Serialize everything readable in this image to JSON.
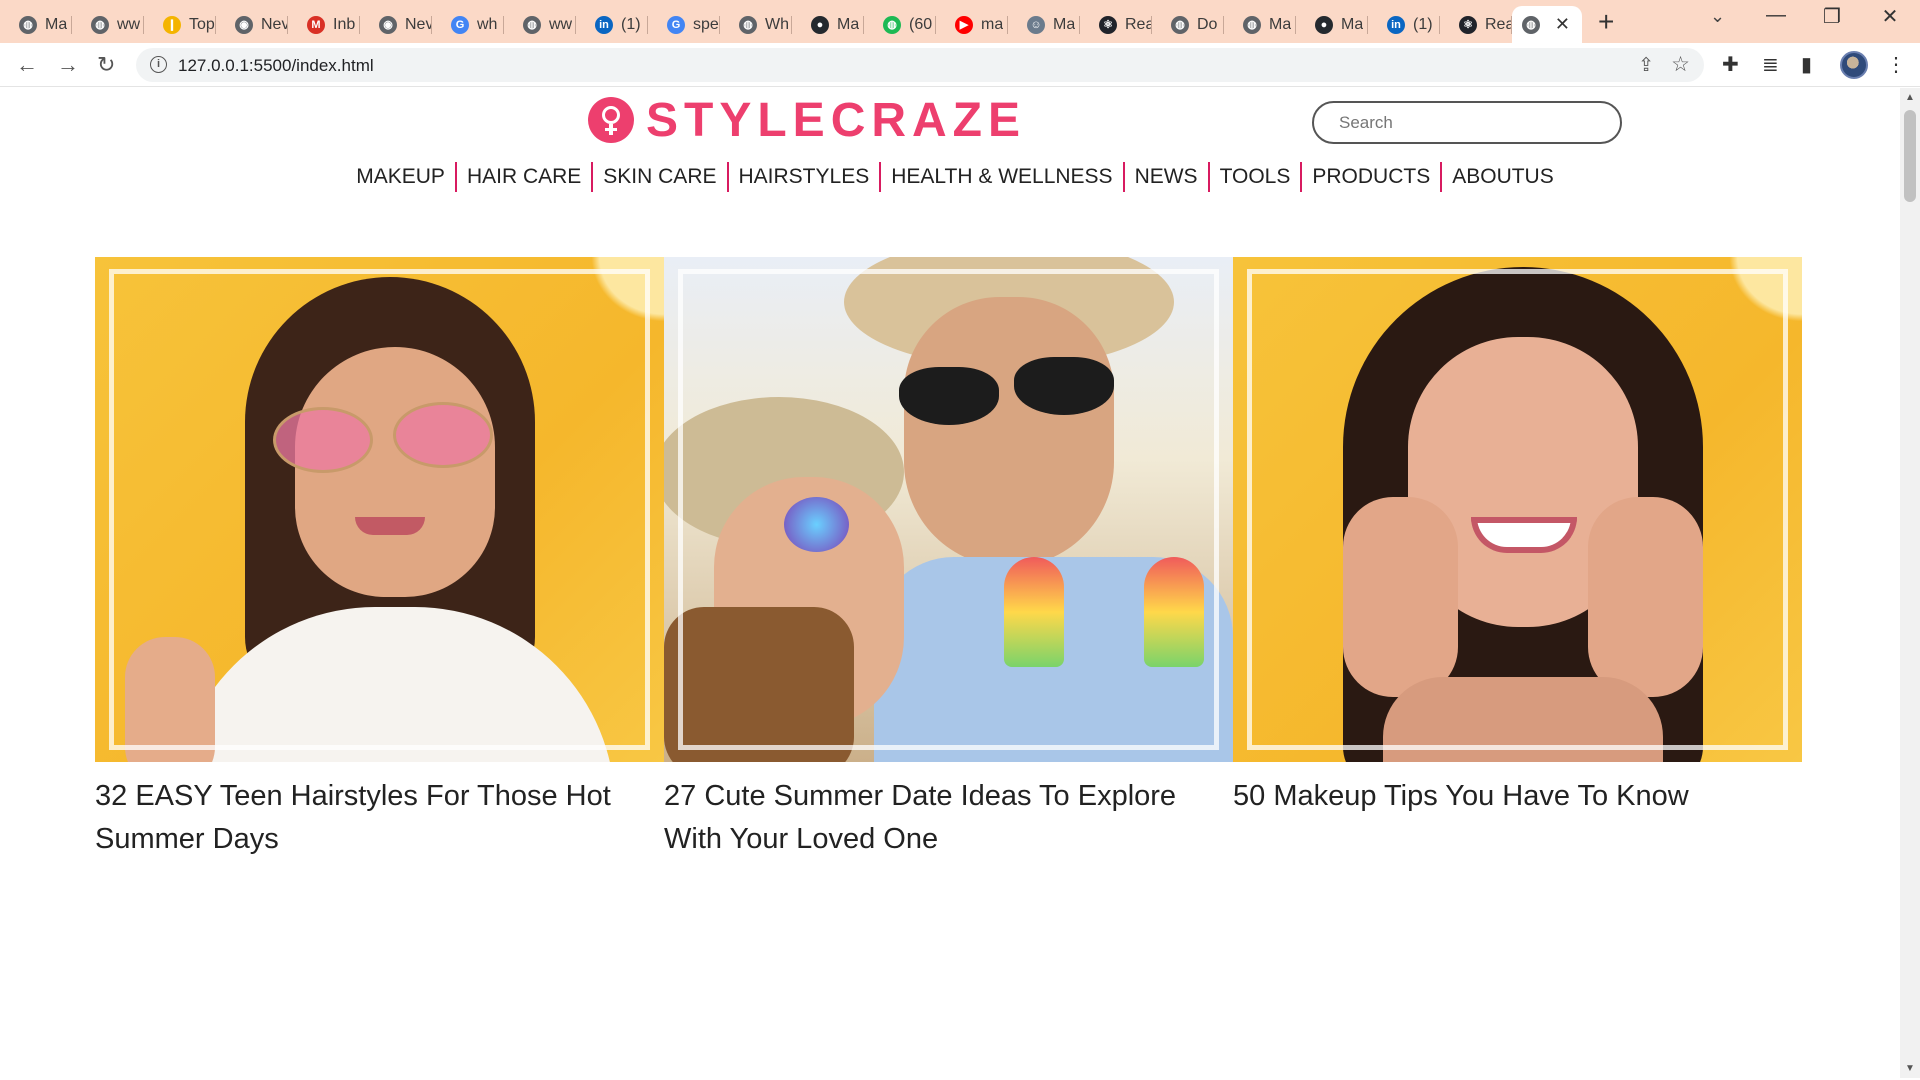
{
  "browser": {
    "tabs": [
      {
        "label": "Ma",
        "icon": "globe-icon",
        "color": "#5f6368"
      },
      {
        "label": "ww",
        "icon": "globe-icon",
        "color": "#5f6368"
      },
      {
        "label": "Top",
        "icon": "bookmark-icon",
        "color": "#f4b400"
      },
      {
        "label": "Nev",
        "icon": "chrome-icon",
        "color": "#5f6368"
      },
      {
        "label": "Inb",
        "icon": "gmail-icon",
        "color": "#d93025"
      },
      {
        "label": "Nev",
        "icon": "chrome-icon",
        "color": "#5f6368"
      },
      {
        "label": "wh",
        "icon": "google-icon",
        "color": "#4285f4"
      },
      {
        "label": "ww",
        "icon": "globe-icon",
        "color": "#5f6368"
      },
      {
        "label": "(1)",
        "icon": "linkedin-icon",
        "color": "#0a66c2"
      },
      {
        "label": "spe",
        "icon": "google-icon",
        "color": "#4285f4"
      },
      {
        "label": "Wh",
        "icon": "globe-icon",
        "color": "#5f6368"
      },
      {
        "label": "Ma",
        "icon": "github-icon",
        "color": "#24292e"
      },
      {
        "label": "(60",
        "icon": "green-circle-icon",
        "color": "#1db954"
      },
      {
        "label": "ma",
        "icon": "youtube-icon",
        "color": "#ff0000"
      },
      {
        "label": "Ma",
        "icon": "avatar-icon",
        "color": "#6b7b8c"
      },
      {
        "label": "Rea",
        "icon": "react-icon",
        "color": "#20232a"
      },
      {
        "label": "Do",
        "icon": "globe-icon",
        "color": "#5f6368"
      },
      {
        "label": "Ma",
        "icon": "globe-icon",
        "color": "#5f6368"
      },
      {
        "label": "Ma",
        "icon": "github-icon",
        "color": "#24292e"
      },
      {
        "label": "(1)",
        "icon": "linkedin-icon",
        "color": "#0a66c2"
      },
      {
        "label": "Rea",
        "icon": "react-icon",
        "color": "#20232a"
      }
    ],
    "active_tab_close": "✕",
    "url": "127.0.0.1:5500/index.html"
  },
  "site": {
    "logo_text": "STYLECRAZE",
    "brand_color": "#ed3f6e",
    "search_placeholder": "Search",
    "nav": [
      "MAKEUP",
      "HAIR CARE",
      "SKIN CARE",
      "HAIRSTYLES",
      "HEALTH & WELLNESS",
      "NEWS",
      "TOOLS",
      "PRODUCTS",
      "ABOUTUS"
    ],
    "nav_divider_color": "#d81b60",
    "cards": [
      {
        "title": "32 EASY Teen Hairstyles For Those Hot Summer Days",
        "image": "teen-girl-pink-sunglasses-photo"
      },
      {
        "title": "27 Cute Summer Date Ideas To Explore With Your Loved One",
        "image": "couple-ice-cream-photo"
      },
      {
        "title": "50 Makeup Tips You Have To Know",
        "image": "smiling-woman-photo"
      }
    ]
  }
}
